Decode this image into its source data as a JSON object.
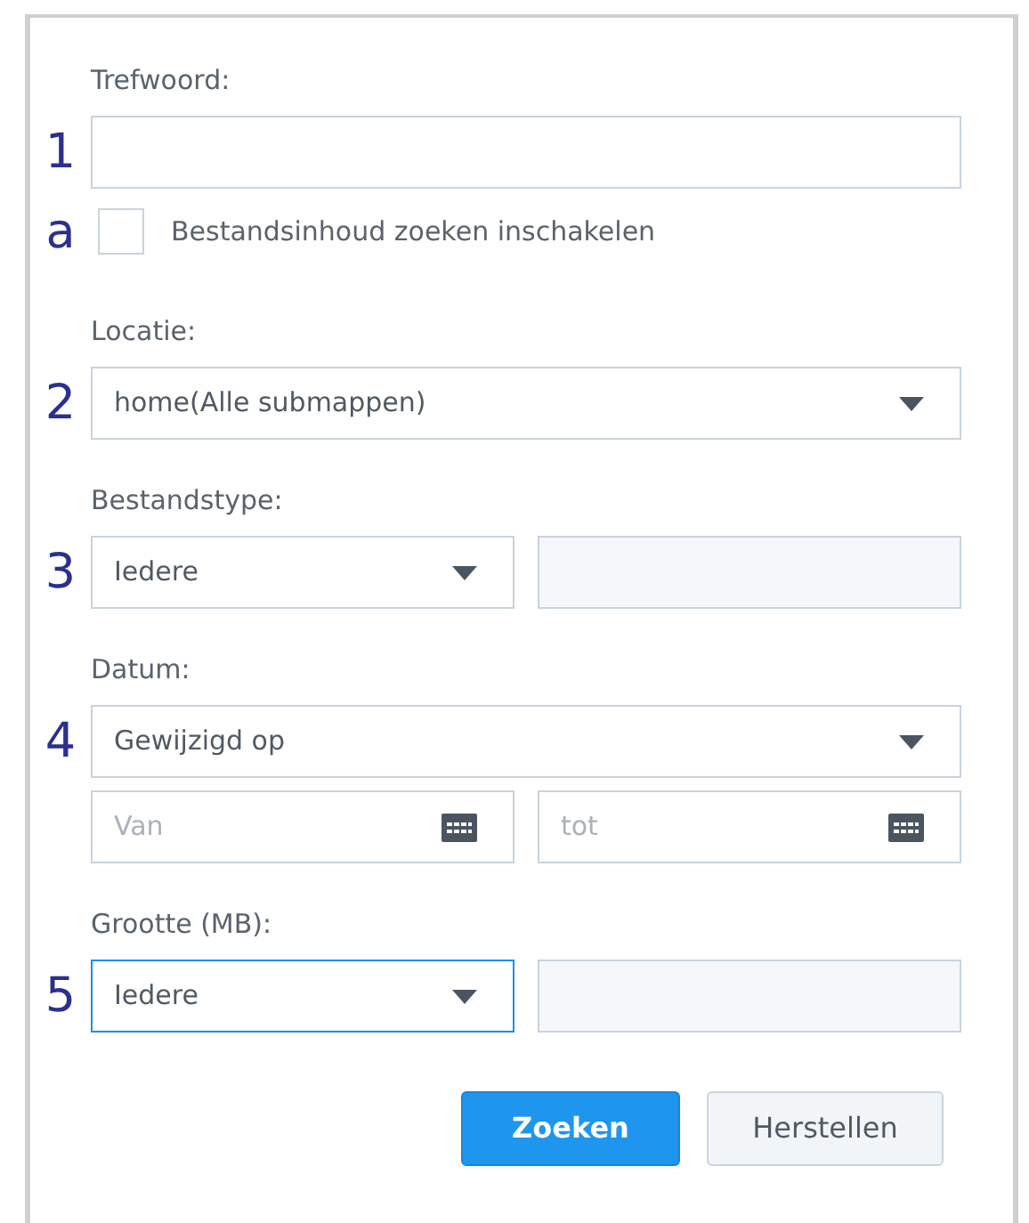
{
  "form": [
    {
      "kind": "label",
      "text": "Trefwoord:"
    },
    {
      "kind": "row",
      "marker": "1",
      "controls": [
        {
          "kind": "text"
        }
      ]
    },
    {
      "kind": "checkbox",
      "marker": "a",
      "label": "Bestandsinhoud zoeken inschakelen",
      "checked": false
    },
    {
      "kind": "label",
      "text": "Locatie:"
    },
    {
      "kind": "row",
      "marker": "2",
      "controls": [
        {
          "kind": "select",
          "value": "home(Alle submappen)",
          "focused": false
        }
      ]
    },
    {
      "kind": "label",
      "text": "Bestandstype:"
    },
    {
      "kind": "row",
      "marker": "3",
      "controls": [
        {
          "kind": "select",
          "value": "Iedere",
          "focused": false
        },
        {
          "kind": "disabled"
        }
      ]
    },
    {
      "kind": "label",
      "text": "Datum:"
    },
    {
      "kind": "row",
      "marker": "4",
      "controls": [
        {
          "kind": "select",
          "value": "Gewijzigd op",
          "focused": false
        }
      ]
    },
    {
      "kind": "row",
      "controls": [
        {
          "kind": "date",
          "placeholder": "Van"
        },
        {
          "kind": "date",
          "placeholder": "tot"
        }
      ]
    },
    {
      "kind": "label",
      "text": "Grootte (MB):"
    },
    {
      "kind": "row",
      "marker": "5",
      "controls": [
        {
          "kind": "select",
          "value": "Iedere",
          "focused": true
        },
        {
          "kind": "disabled"
        }
      ]
    }
  ],
  "buttons": [
    {
      "label": "Zoeken",
      "primary": true
    },
    {
      "label": "Herstellen",
      "primary": false
    }
  ]
}
